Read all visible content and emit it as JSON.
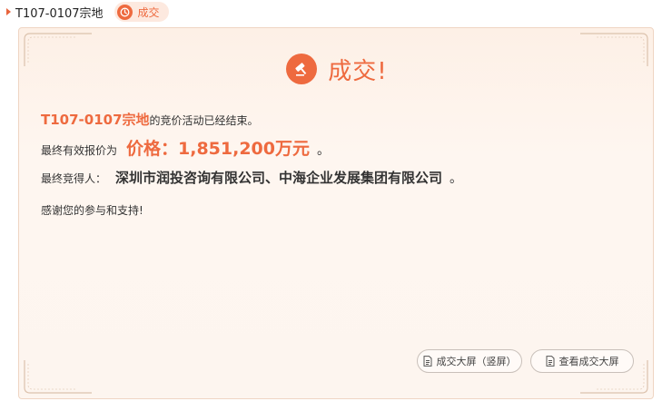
{
  "header": {
    "title": "T107-0107宗地",
    "badge_label": "成交"
  },
  "card": {
    "result_title": "成交!",
    "line1": {
      "code": "T107-0107宗地",
      "text": "的竞价活动已经结束。"
    },
    "line2": {
      "label": "最终有效报价为",
      "price": "价格：1,851,200万元",
      "end": "。"
    },
    "line3": {
      "label": "最终竞得人：",
      "winner": "深圳市润投咨询有限公司、中海企业发展集团有限公司",
      "end": "。"
    },
    "line4": "感谢您的参与和支持!",
    "buttons": {
      "vertical_screen": "成交大屏（竖屏）",
      "view_screen": "查看成交大屏"
    }
  },
  "colors": {
    "accent": "#ee6a3f",
    "card_bg": "#fdf3eb",
    "card_border": "#efd5c3"
  },
  "icons": [
    "play-arrow-icon",
    "clock-icon",
    "hammer-icon",
    "document-icon"
  ]
}
